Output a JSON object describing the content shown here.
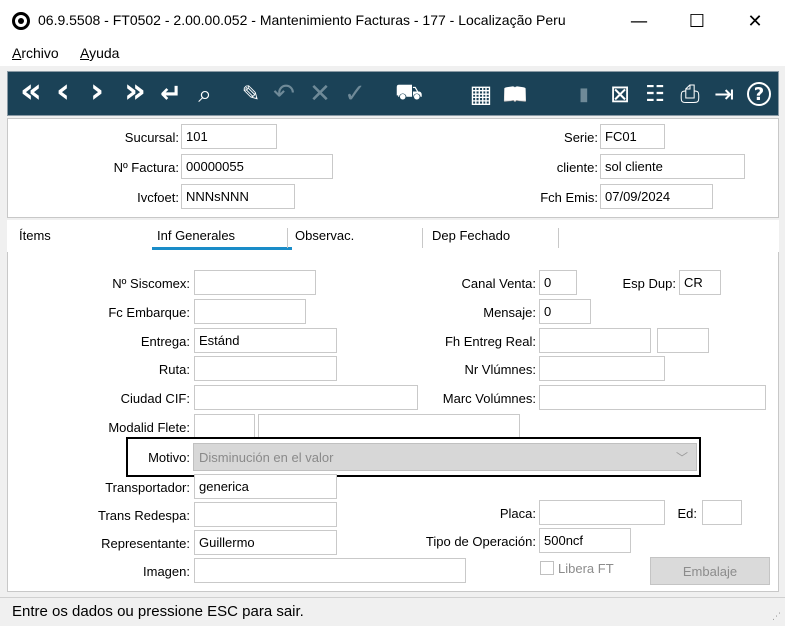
{
  "window": {
    "title": "06.9.5508 - FT0502 - 2.00.00.052 - Mantenimiento Facturas - 177 - Localização Peru",
    "minimize": "—",
    "maximize": "☐",
    "close": "✕"
  },
  "menu": {
    "archivo_first": "A",
    "archivo_rest": "rchivo",
    "ayuda_first": "A",
    "ayuda_rest": "yuda"
  },
  "toolbar": {
    "icons": {
      "first": "«",
      "prev": "‹",
      "next": "›",
      "last": "»",
      "enter": "↵",
      "search": "⌕",
      "edit": "✎",
      "undo": "↶",
      "cancel": "✕",
      "confirm": "✓",
      "delivery": "⛟",
      "calculator": "▦",
      "book": "📖",
      "report": "▮",
      "excel": "⊠",
      "tree": "☷",
      "print": "⎙",
      "exit": "⇥",
      "help": "?"
    }
  },
  "header": {
    "sucursal_label": "Sucursal:",
    "sucursal_value": "101",
    "factura_label": "Nº Factura:",
    "factura_value": "00000055",
    "ivcfoet_label": "Ivcfoet:",
    "ivcfoet_value": "NNNsNNN",
    "serie_label": "Serie:",
    "serie_value": "FC01",
    "cliente_label": "cliente:",
    "cliente_value": "sol cliente",
    "fch_label": "Fch Emis:",
    "fch_value": "07/09/2024"
  },
  "tabs": [
    {
      "label": "Ítems"
    },
    {
      "label": "Inf Generales",
      "active": true
    },
    {
      "label": "Observac."
    },
    {
      "label": "Dep Fechado"
    }
  ],
  "form": {
    "siscomex_label": "Nº Siscomex:",
    "siscomex_value": "",
    "canal_label": "Canal Venta:",
    "canal_value": "0",
    "espdup_label": "Esp Dup:",
    "espdup_value": "CR",
    "fcembarque_label": "Fc Embarque:",
    "fcembarque_value": "",
    "mensaje_label": "Mensaje:",
    "mensaje_value": "0",
    "entrega_label": "Entrega:",
    "entrega_value": "Estánd",
    "fhentreg_label": "Fh Entreg Real:",
    "fhentreg_value": "",
    "fhentreg_time": "",
    "ruta_label": "Ruta:",
    "ruta_value": "",
    "nrvol_label": "Nr Vlúmnes:",
    "nrvol_value": "",
    "ciudad_label": "Ciudad CIF:",
    "ciudad_value": "",
    "marcvol_label": "Marc Volúmnes:",
    "marcvol_value": "",
    "modalid_label": "Modalid Flete:",
    "modalid_code": "",
    "modalid_desc": "",
    "motivo_label": "Motivo:",
    "motivo_value": "Disminución en el valor",
    "transportador_label": "Transportador:",
    "transportador_value": "generica",
    "transredespa_label": "Trans Redespa:",
    "transredespa_value": "",
    "placa_label": "Placa:",
    "placa_value": "",
    "ed_label": "Ed:",
    "ed_value": "",
    "representante_label": "Representante:",
    "representante_value": "Guillermo",
    "tipoop_label": "Tipo de Operación:",
    "tipoop_value": "500ncf",
    "imagen_label": "Imagen:",
    "imagen_value": "",
    "libera_label": "Libera FT",
    "embalaje_label": "Embalaje"
  },
  "status": {
    "text": "Entre os dados ou pressione ESC para sair."
  }
}
